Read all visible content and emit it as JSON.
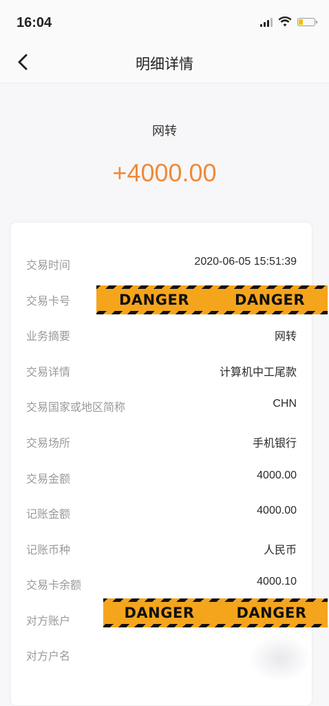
{
  "status_bar": {
    "time": "16:04"
  },
  "nav": {
    "title": "明细详情"
  },
  "summary": {
    "type": "网转",
    "amount": "+4000.00"
  },
  "details": [
    {
      "label": "交易时间",
      "value": "2020-06-05 15:51:39"
    },
    {
      "label": "交易卡号",
      "value": ""
    },
    {
      "label": "业务摘要",
      "value": "网转"
    },
    {
      "label": "交易详情",
      "value": "计算机中工尾款"
    },
    {
      "label": "交易国家或地区简称",
      "value": "CHN"
    },
    {
      "label": "交易场所",
      "value": "手机银行"
    },
    {
      "label": "交易金额",
      "value": "4000.00"
    },
    {
      "label": "记账金额",
      "value": "4000.00"
    },
    {
      "label": "记账币种",
      "value": "人民币"
    },
    {
      "label": "交易卡余额",
      "value": "4000.10"
    },
    {
      "label": "对方账户",
      "value": ""
    },
    {
      "label": "对方户名",
      "value": ""
    }
  ],
  "redactions": {
    "tape1": {
      "left": "DANGER",
      "right": "DANGER"
    },
    "tape2": {
      "left": "DANGER",
      "right": "DANGER"
    }
  },
  "colors": {
    "amount": "#ee8a3a",
    "tape_yellow": "#f5a51c"
  }
}
